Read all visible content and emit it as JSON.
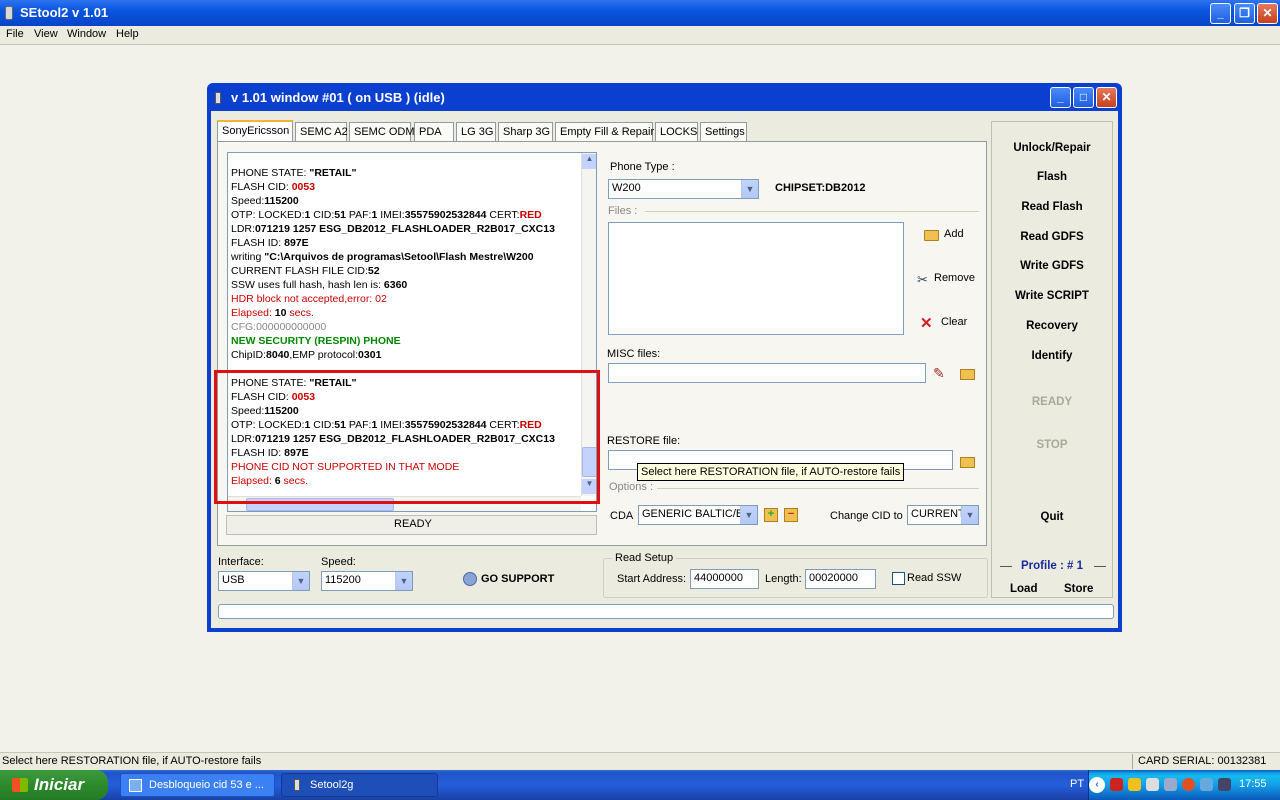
{
  "app": {
    "title": "SEtool2 v 1.01"
  },
  "menu": [
    "File",
    "View",
    "Window",
    "Help"
  ],
  "child_window": {
    "title": "v 1.01 window #01 ( on USB ) (idle)",
    "tabs": [
      "SonyEricsson",
      "SEMC A2",
      "SEMC ODM",
      "PDA",
      "LG 3G",
      "Sharp 3G",
      "Empty Fill & Repair",
      "LOCKS",
      "Settings"
    ],
    "log_block1": {
      "l1a": "PHONE STATE: ",
      "l1b": "\"RETAIL\"",
      "l2a": "FLASH CID: ",
      "l2b": "0053",
      "l3a": "Speed:",
      "l3b": "115200",
      "l4a": "OTP: LOCKED:",
      "l4b": "1",
      "l4c": " CID:",
      "l4d": "51",
      "l4e": " PAF:",
      "l4f": "1",
      "l4g": " IMEI:",
      "l4h": "35575902532844",
      "l4i": " CERT:",
      "l4j": "RED",
      "l5a": "LDR:",
      "l5b": "071219 1257 ESG_DB2012_FLASHLOADER_R2B017_CXC13",
      "l6a": "FLASH ID: ",
      "l6b": "897E",
      "l7a": "writing ",
      "l7b": "\"C:\\Arquivos de programas\\Setool\\Flash Mestre\\W200",
      "l8a": "CURRENT FLASH FILE CID:",
      "l8b": "52",
      "l9a": "SSW uses full hash, hash len is: ",
      "l9b": "6360",
      "l10": "HDR block not accepted,error: 02",
      "l11a": "Elapsed: ",
      "l11b": "10",
      "l11c": " secs.",
      "l12": "CFG:000000000000",
      "l13": "NEW SECURITY (RESPIN) PHONE",
      "l14a": "ChipID:",
      "l14b": "8040",
      "l14c": ",EMP protocol:",
      "l14d": "0301"
    },
    "log_block2": {
      "l1a": "PHONE STATE: ",
      "l1b": "\"RETAIL\"",
      "l2a": "FLASH CID: ",
      "l2b": "0053",
      "l3a": "Speed:",
      "l3b": "115200",
      "l4a": "OTP: LOCKED:",
      "l4b": "1",
      "l4c": " CID:",
      "l4d": "51",
      "l4e": " PAF:",
      "l4f": "1",
      "l4g": " IMEI:",
      "l4h": "35575902532844",
      "l4i": " CERT:",
      "l4j": "RED",
      "l5a": "LDR:",
      "l5b": "071219 1257 ESG_DB2012_FLASHLOADER_R2B017_CXC13",
      "l6a": "FLASH ID: ",
      "l6b": "897E",
      "l7": "PHONE CID NOT SUPPORTED IN THAT MODE",
      "l8a": "Elapsed: ",
      "l8b": "6",
      "l8c": " secs."
    },
    "log_status": "READY",
    "phone_type_label": "Phone Type :",
    "phone_type_value": "W200",
    "chipset": "CHIPSET:DB2012",
    "files_label": "Files :",
    "add_label": "Add",
    "remove_label": "Remove",
    "clear_label": "Clear",
    "misc_label": "MISC files:",
    "restore_label": "RESTORE file:",
    "tooltip": "Select here RESTORATION file, if AUTO-restore fails",
    "options_label": "Options :",
    "cda_label": "CDA",
    "cda_value": "GENERIC BALTIC/BA",
    "change_cid_label": "Change CID to",
    "change_cid_value": "CURRENT",
    "interface_label": "Interface:",
    "interface_value": "USB",
    "speed_label": "Speed:",
    "speed_value": "115200",
    "go_support": "GO SUPPORT",
    "read_setup_label": "Read Setup",
    "start_address_label": "Start Address:",
    "start_address_value": "44000000",
    "length_label": "Length:",
    "length_value": "00020000",
    "read_ssw_label": "Read SSW",
    "side_buttons": [
      "Unlock/Repair",
      "Flash",
      "Read Flash",
      "Read GDFS",
      "Write GDFS",
      "Write SCRIPT",
      "Recovery",
      "Identify"
    ],
    "ready_label": "READY",
    "stop_label": "STOP",
    "quit_label": "Quit",
    "profile_label": "Profile : # 1",
    "load_label": "Load",
    "store_label": "Store"
  },
  "statusbar": {
    "left": "Select here RESTORATION file, if AUTO-restore fails",
    "right": "CARD SERIAL: 00132381"
  },
  "taskbar": {
    "start": "Iniciar",
    "tasks": [
      "Desbloqueio cid 53 e ...",
      "Setool2g"
    ],
    "lang": "PT",
    "clock": "17:55"
  }
}
